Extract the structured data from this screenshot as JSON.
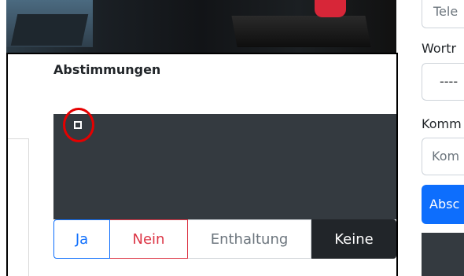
{
  "main": {
    "section_title": "Abstimmungen",
    "vote_buttons": {
      "ja": "Ja",
      "nein": "Nein",
      "enthaltung": "Enthaltung",
      "keine": "Keine"
    }
  },
  "right_column": {
    "input_top_placeholder": "Tele",
    "wortmeldung_label": "Wortr",
    "select_value": "----",
    "kommentar_label": "Komm",
    "kommentar_placeholder": "Kom",
    "submit_label": "Absc"
  },
  "colors": {
    "primary": "#0d6efd",
    "danger": "#dc3545",
    "dark": "#212529",
    "video_bg": "#343a40",
    "highlight_circle": "#e60000"
  }
}
